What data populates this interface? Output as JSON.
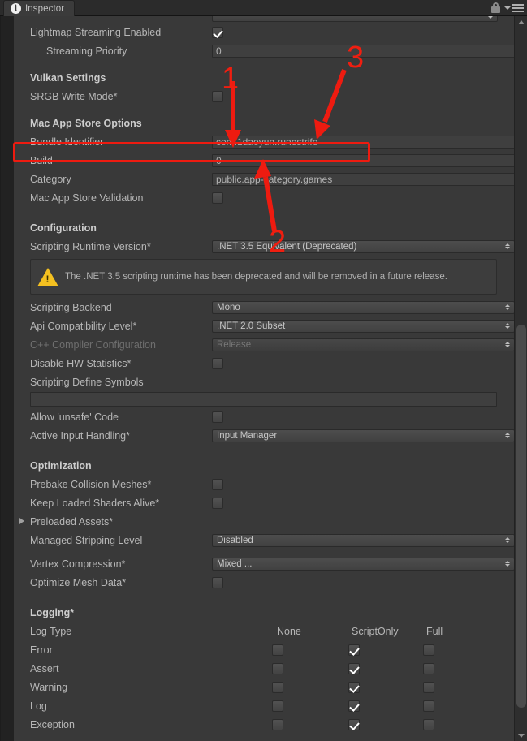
{
  "window": {
    "tab_label": "Inspector",
    "tab_icon": "info-icon",
    "lock_icon": "lock-icon",
    "menu_icon": "hamburger-menu-icon"
  },
  "rows": {
    "lightmap_streaming_enabled": {
      "label": "Lightmap Streaming Enabled",
      "checked": true
    },
    "streaming_priority": {
      "label": "Streaming Priority",
      "value": "0"
    },
    "vulkan_settings": {
      "label": "Vulkan Settings"
    },
    "srgb_write_mode": {
      "label": "SRGB Write Mode*",
      "checked": false
    },
    "mac_app_store_options": {
      "label": "Mac App Store Options"
    },
    "bundle_identifier": {
      "label": "Bundle Identifier",
      "value": "com.1daoyun.runestrife"
    },
    "build": {
      "label": "Build",
      "value": "0"
    },
    "category": {
      "label": "Category",
      "value": "public.app-category.games"
    },
    "mac_app_store_validation": {
      "label": "Mac App Store Validation",
      "checked": false
    },
    "configuration": {
      "label": "Configuration"
    },
    "scripting_runtime_version": {
      "label": "Scripting Runtime Version*",
      "value": ".NET 3.5 Equivalent (Deprecated)"
    },
    "deprecation_warning": {
      "icon": "warning-triangle-icon",
      "text": "The .NET 3.5 scripting runtime has been deprecated and will be removed in a future release."
    },
    "scripting_backend": {
      "label": "Scripting Backend",
      "value": "Mono"
    },
    "api_compatibility_level": {
      "label": "Api Compatibility Level*",
      "value": ".NET 2.0 Subset"
    },
    "cpp_compiler_configuration": {
      "label": "C++ Compiler Configuration",
      "value": "Release",
      "disabled": true
    },
    "disable_hw_statistics": {
      "label": "Disable HW Statistics*",
      "checked": false
    },
    "scripting_define_symbols": {
      "label": "Scripting Define Symbols",
      "value": ""
    },
    "allow_unsafe_code": {
      "label": "Allow 'unsafe' Code",
      "checked": false
    },
    "active_input_handling": {
      "label": "Active Input Handling*",
      "value": "Input Manager"
    },
    "optimization": {
      "label": "Optimization"
    },
    "prebake_collision_meshes": {
      "label": "Prebake Collision Meshes*",
      "checked": false
    },
    "keep_loaded_shaders_alive": {
      "label": "Keep Loaded Shaders Alive*",
      "checked": false
    },
    "preloaded_assets": {
      "label": "Preloaded Assets*"
    },
    "managed_stripping_level": {
      "label": "Managed Stripping Level",
      "value": "Disabled"
    },
    "vertex_compression": {
      "label": "Vertex Compression*",
      "value": "Mixed ..."
    },
    "optimize_mesh_data": {
      "label": "Optimize Mesh Data*",
      "checked": false
    },
    "logging": {
      "label": "Logging*"
    }
  },
  "logging_table": {
    "row_header": "Log Type",
    "columns": [
      "None",
      "ScriptOnly",
      "Full"
    ],
    "rows": [
      {
        "label": "Error",
        "none": false,
        "scriptonly": true,
        "full": false
      },
      {
        "label": "Assert",
        "none": false,
        "scriptonly": true,
        "full": false
      },
      {
        "label": "Warning",
        "none": false,
        "scriptonly": true,
        "full": false
      },
      {
        "label": "Log",
        "none": false,
        "scriptonly": true,
        "full": false
      },
      {
        "label": "Exception",
        "none": false,
        "scriptonly": true,
        "full": false
      }
    ]
  },
  "annotations": {
    "color": "#ee1b10",
    "markers": [
      {
        "number": "1",
        "points_to": "bundle-identifier-value-start"
      },
      {
        "number": "2",
        "points_to": "bundle-identifier-field"
      },
      {
        "number": "3",
        "points_to": "bundle-identifier-value-end"
      }
    ],
    "highlight_box": "bundle-identifier-row"
  }
}
